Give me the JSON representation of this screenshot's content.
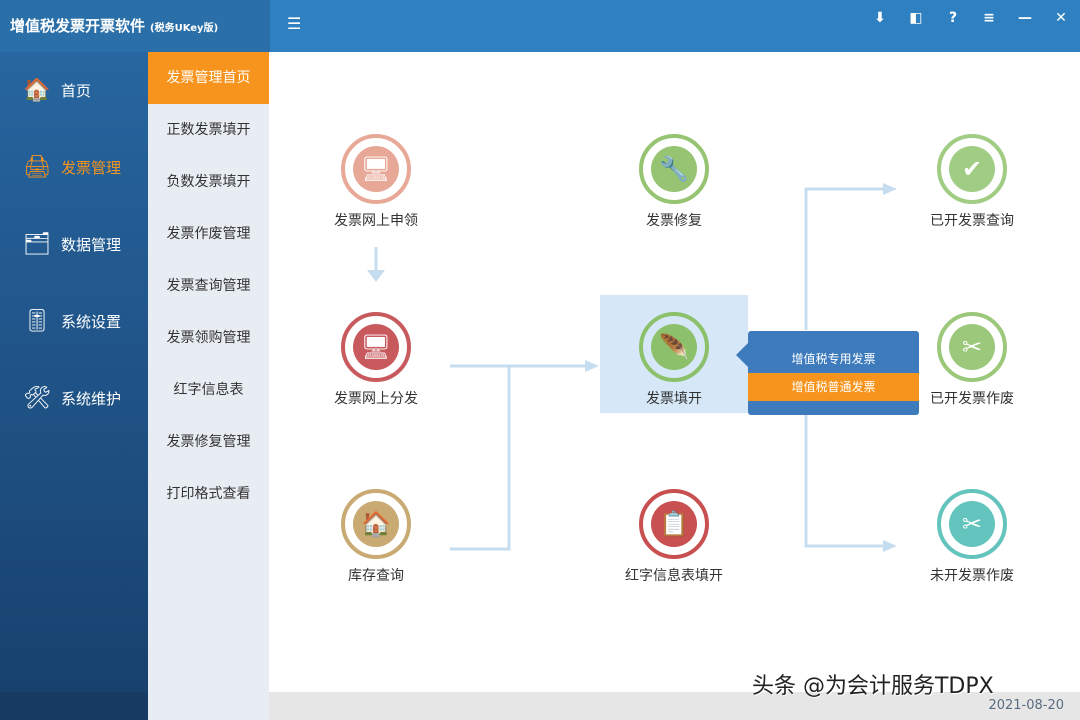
{
  "app": {
    "title": "增值税发票开票软件",
    "edition": "(税务UKey版)"
  },
  "toolbar": {
    "collapse": "☰",
    "download": "⬇",
    "bookmark": "◧",
    "help": "?",
    "menu": "≡",
    "minimize": "—",
    "close": "✕"
  },
  "sidebar": {
    "items": [
      {
        "label": "首页",
        "icon": "🏠"
      },
      {
        "label": "发票管理",
        "icon": "🖨"
      },
      {
        "label": "数据管理",
        "icon": "🗂"
      },
      {
        "label": "系统设置",
        "icon": "🎚"
      },
      {
        "label": "系统维护",
        "icon": "🛠"
      }
    ]
  },
  "submenu": {
    "items": [
      "发票管理首页",
      "正数发票填开",
      "负数发票填开",
      "发票作废管理",
      "发票查询管理",
      "发票领购管理",
      "红字信息表",
      "发票修复管理",
      "打印格式查看"
    ]
  },
  "flow": {
    "nodes": [
      {
        "label": "发票网上申领",
        "icon": "🖥",
        "color": "#e8a898"
      },
      {
        "label": "发票网上分发",
        "icon": "🖥",
        "color": "#c85a5e"
      },
      {
        "label": "库存查询",
        "icon": "🏠",
        "color": "#c8aa72"
      },
      {
        "label": "发票修复",
        "icon": "🔧",
        "color": "#96c472"
      },
      {
        "label": "发票填开",
        "icon": "🪶",
        "color": "#8cc06a"
      },
      {
        "label": "红字信息表填开",
        "icon": "📋",
        "color": "#c85050"
      },
      {
        "label": "已开发票查询",
        "icon": "✔",
        "color": "#a0cc84"
      },
      {
        "label": "已开发票作废",
        "icon": "✂",
        "color": "#9cc87c"
      },
      {
        "label": "未开发票作废",
        "icon": "✂",
        "color": "#62c4bc"
      }
    ]
  },
  "popup": {
    "items": [
      "增值税专用发票",
      "增值税普通发票"
    ],
    "active": 1
  },
  "status": {
    "date": "2021-08-20"
  },
  "watermark": "头条 @为会计服务TDPX"
}
